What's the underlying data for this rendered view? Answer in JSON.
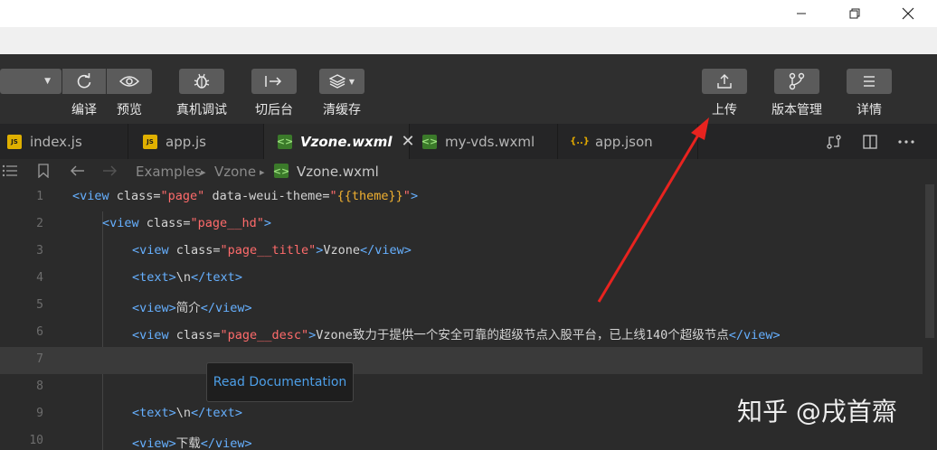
{
  "window": {
    "minimize_icon": "minimize-icon",
    "maximize_icon": "restore-icon",
    "close_icon": "close-icon"
  },
  "toolbar": {
    "compile_label": "编译",
    "preview_label": "预览",
    "debug_label": "真机调试",
    "background_label": "切后台",
    "clear_cache_label": "清缓存",
    "upload_label": "上传",
    "version_label": "版本管理",
    "details_label": "详情"
  },
  "tabs": [
    {
      "label": "index.js",
      "icon": "js-file-icon",
      "icon_text": "JS"
    },
    {
      "label": "app.js",
      "icon": "js-file-icon",
      "icon_text": "JS"
    },
    {
      "label": "Vzone.wxml",
      "icon": "wxml-file-icon",
      "icon_text": "<>",
      "active": true
    },
    {
      "label": "my-vds.wxml",
      "icon": "wxml-file-icon",
      "icon_text": "<>"
    },
    {
      "label": "app.json",
      "icon": "json-file-icon",
      "icon_text": "{..}"
    }
  ],
  "breadcrumb": {
    "folder": "Examples",
    "subfolder": "Vzone",
    "file": "Vzone.wxml"
  },
  "editor": {
    "line_numbers": [
      "1",
      "2",
      "3",
      "4",
      "5",
      "6",
      "7",
      "8",
      "9",
      "10"
    ],
    "current_line": 7,
    "lines": {
      "l1": {
        "open": "<view",
        "a1": " class=",
        "v1": "\"page\"",
        "a2": " data-weui-theme=",
        "q1": "\"",
        "e1": "{{theme}}",
        "q2": "\"",
        "close": ">"
      },
      "l2": {
        "open": "<view",
        "a1": " class=",
        "v1": "\"page__hd\"",
        "close": ">"
      },
      "l3": {
        "open": "<view",
        "a1": " class=",
        "v1": "\"page__title\"",
        "close": ">",
        "text": "Vzone",
        "end": "</view>"
      },
      "l4": {
        "open": "<text>",
        "text": "\\n",
        "end": "</text>"
      },
      "l5": {
        "open": "<view>",
        "text": "简介",
        "end": "</view>"
      },
      "l6": {
        "open": "<view",
        "a1": " class=",
        "v1": "\"page__desc\"",
        "close": ">",
        "text": "Vzone致力于提供一个安全可靠的超级节点入股平台，已上线140个超级节点",
        "end": "</view>"
      },
      "l9": {
        "open": "<text>",
        "text": "\\n",
        "end": "</text>"
      },
      "l10": {
        "open": "<view>",
        "text": "下载",
        "end": "</view>"
      }
    }
  },
  "tooltip": {
    "label": "Read Documentation"
  },
  "watermark": "知乎 @戌首齋",
  "colors": {
    "tag": "#66b0ff",
    "string": "#ff6b6b",
    "expression": "#f0b030",
    "arrow": "#e8231f"
  }
}
